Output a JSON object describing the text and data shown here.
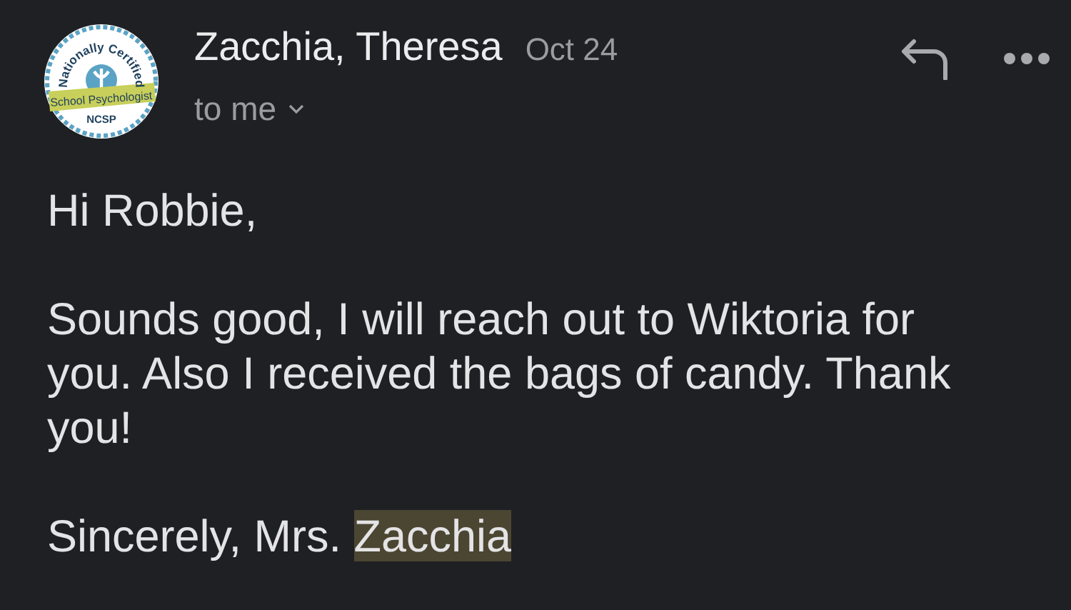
{
  "avatar": {
    "top_text": "Nationally Certified",
    "band_text": "School Psychologist",
    "bottom_text": "NCSP"
  },
  "sender": {
    "name": "Zacchia, Theresa",
    "date": "Oct 24",
    "recipient": "to me"
  },
  "actions": [
    {
      "kind": "reply"
    },
    {
      "kind": "more"
    }
  ],
  "paragraphs": [
    [
      {
        "text": "Hi Robbie,",
        "highlighted": false
      }
    ],
    [
      {
        "text": "Sounds good, I will reach out to Wiktoria for you. Also I received the bags of candy. Thank you!",
        "highlighted": false
      }
    ],
    [
      {
        "text": "Sincerely, Mrs. ",
        "highlighted": false
      },
      {
        "text": "Zacchia",
        "highlighted": true
      }
    ]
  ]
}
